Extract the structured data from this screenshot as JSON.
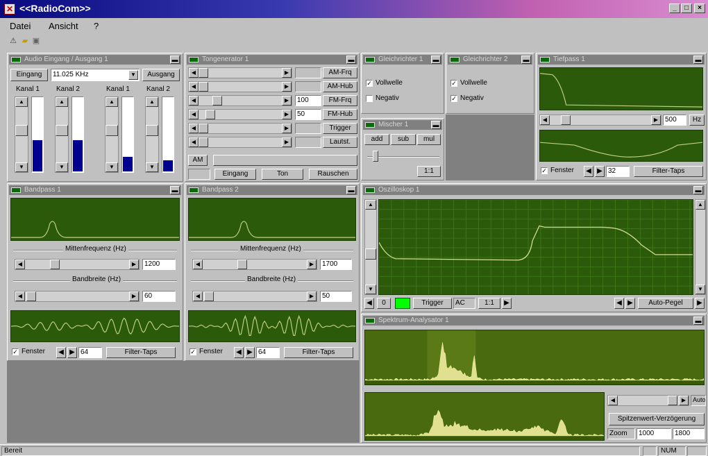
{
  "window": {
    "title": "<<RadioCom>>",
    "min": "_",
    "max": "□",
    "close": "×"
  },
  "menu": {
    "file": "Datei",
    "view": "Ansicht",
    "help": "?"
  },
  "panels": {
    "audio": {
      "title": "Audio Eingang / Ausgang 1",
      "input_button": "Eingang",
      "rate": "11.025 KHz",
      "output_button": "Ausgang",
      "channels": [
        {
          "label": "Kanal 1",
          "level": 0.42
        },
        {
          "label": "Kanal 2",
          "level": 0.42
        },
        {
          "label": "Kanal 1",
          "level": 0.2
        },
        {
          "label": "Kanal 2",
          "level": 0.15
        }
      ]
    },
    "generator": {
      "title": "Tongenerator 1",
      "rows": [
        {
          "value": "",
          "label": "AM-Frq"
        },
        {
          "value": "",
          "label": "AM-Hub"
        },
        {
          "value": "100",
          "label": "FM-Frq"
        },
        {
          "value": "50",
          "label": "FM-Hub"
        },
        {
          "value": "",
          "label": "Trigger"
        },
        {
          "value": "",
          "label": "Lautst."
        }
      ],
      "am": "AM",
      "input": "Eingang",
      "tone": "Ton",
      "noise": "Rauschen"
    },
    "display1": {
      "title": "Gleichrichter 1",
      "pos": "Vollwelle",
      "neg": "Negativ"
    },
    "display2": {
      "title": "Gleichrichter 2",
      "pos": "Vollwelle",
      "neg": "Negativ"
    },
    "mixer": {
      "title": "Mischer 1",
      "add": "add",
      "sub": "sub",
      "mul": "mul",
      "ratio": "1:1"
    },
    "filter": {
      "title": "Tiefpass 1",
      "value": "500",
      "unit": "Hz",
      "window": "Fenster",
      "taps": "32",
      "taps_btn": "Filter-Taps"
    },
    "bp1": {
      "title": "Bandpass 1",
      "center_label": "Mittenfrequenz (Hz)",
      "center": "1200",
      "bw_label": "Bandbreite (Hz)",
      "bw": "60",
      "window": "Fenster",
      "taps": "64",
      "taps_btn": "Filter-Taps"
    },
    "bp2": {
      "title": "Bandpass 2",
      "center_label": "Mittenfrequenz (Hz)",
      "center": "1700",
      "bw_label": "Bandbreite (Hz)",
      "bw": "50",
      "window": "Fenster",
      "taps": "64",
      "taps_btn": "Filter-Taps"
    },
    "scope": {
      "title": "Oszilloskop 1",
      "trigger": "Trigger",
      "ac": "AC",
      "ratio": "1:1",
      "auto": "Auto-Pegel",
      "zero": "0"
    },
    "spectrum": {
      "title": "Spektrum-Analysator 1",
      "auto": "Auto",
      "peak_btn": "Spitzenwert-Verzögerung",
      "zoom": "Zoom",
      "zoom_from": "1000",
      "zoom_to": "1800"
    }
  },
  "status": {
    "text": "Bereit",
    "right": "NUM"
  }
}
